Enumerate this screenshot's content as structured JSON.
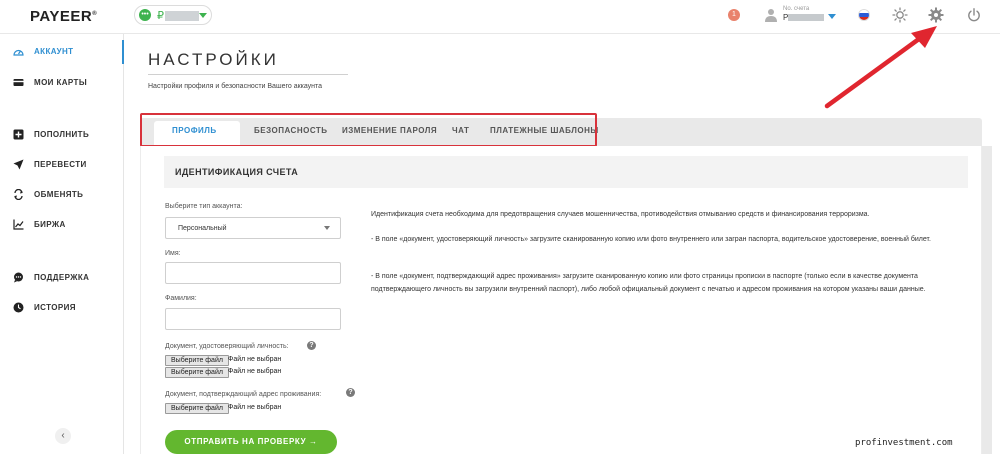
{
  "header": {
    "logo": "PAYEER",
    "balance_currency": "₽",
    "notifications_count": "1",
    "account_label": "No. счета",
    "account_prefix": "P"
  },
  "sidebar": {
    "items": [
      {
        "label": "АККАУНТ",
        "icon": "dashboard-icon",
        "active": true
      },
      {
        "label": "МОИ КАРТЫ",
        "icon": "card-icon"
      },
      {
        "label": "ПОПОЛНИТЬ",
        "icon": "plus-square-icon"
      },
      {
        "label": "ПЕРЕВЕСТИ",
        "icon": "send-icon"
      },
      {
        "label": "ОБМЕНЯТЬ",
        "icon": "exchange-icon"
      },
      {
        "label": "БИРЖА",
        "icon": "chart-icon"
      },
      {
        "label": "ПОДДЕРЖКА",
        "icon": "chat-icon"
      },
      {
        "label": "ИСТОРИЯ",
        "icon": "clock-icon"
      }
    ],
    "collapse": "‹"
  },
  "page": {
    "title": "НАСТРОЙКИ",
    "subtitle": "Настройки профиля и безопасности Вашего аккаунта"
  },
  "tabs": [
    {
      "label": "ПРОФИЛЬ",
      "active": true
    },
    {
      "label": "БЕЗОПАСНОСТЬ"
    },
    {
      "label": "ИЗМЕНЕНИЕ ПАРОЛЯ"
    },
    {
      "label": "ЧАТ"
    },
    {
      "label": "ПЛАТЕЖНЫЕ ШАБЛОНЫ"
    }
  ],
  "form": {
    "section_title": "ИДЕНТИФИКАЦИЯ СЧЕТА",
    "account_type_label": "Выберите тип аккаунта:",
    "account_type_value": "Персональный",
    "first_name_label": "Имя:",
    "last_name_label": "Фамилия:",
    "id_doc_label": "Документ, удостоверяющий личность:",
    "address_doc_label": "Документ, подтверждающий адрес проживания:",
    "choose_file": "Выберите файл",
    "no_file": "Файл не выбран",
    "submit": "ОТПРАВИТЬ НА ПРОВЕРКУ →"
  },
  "info": {
    "p1": "Идентификация счета необходима для предотвращения случаев мошенничества, противодействия отмыванию средств и финансирования терроризма.",
    "p2": "- В поле «документ, удостоверяющий личность» загрузите сканированную копию или фото внутреннего или загран паспорта, водительское удостоверение, военный билет.",
    "p3": "- В поле «документ, подтверждающий адрес проживания» загрузите сканированную копию или фото страницы прописки в паспорте (только если в качестве документа подтверждающего личность вы загрузили внутренний паспорт), либо любой официальный документ с печатью и адресом проживания на котором указаны ваши данные."
  },
  "watermark": "profinvestment.com",
  "colors": {
    "accent_blue": "#2f8fd1",
    "brand_green": "#63b72f",
    "highlight_red": "#d8323b"
  }
}
